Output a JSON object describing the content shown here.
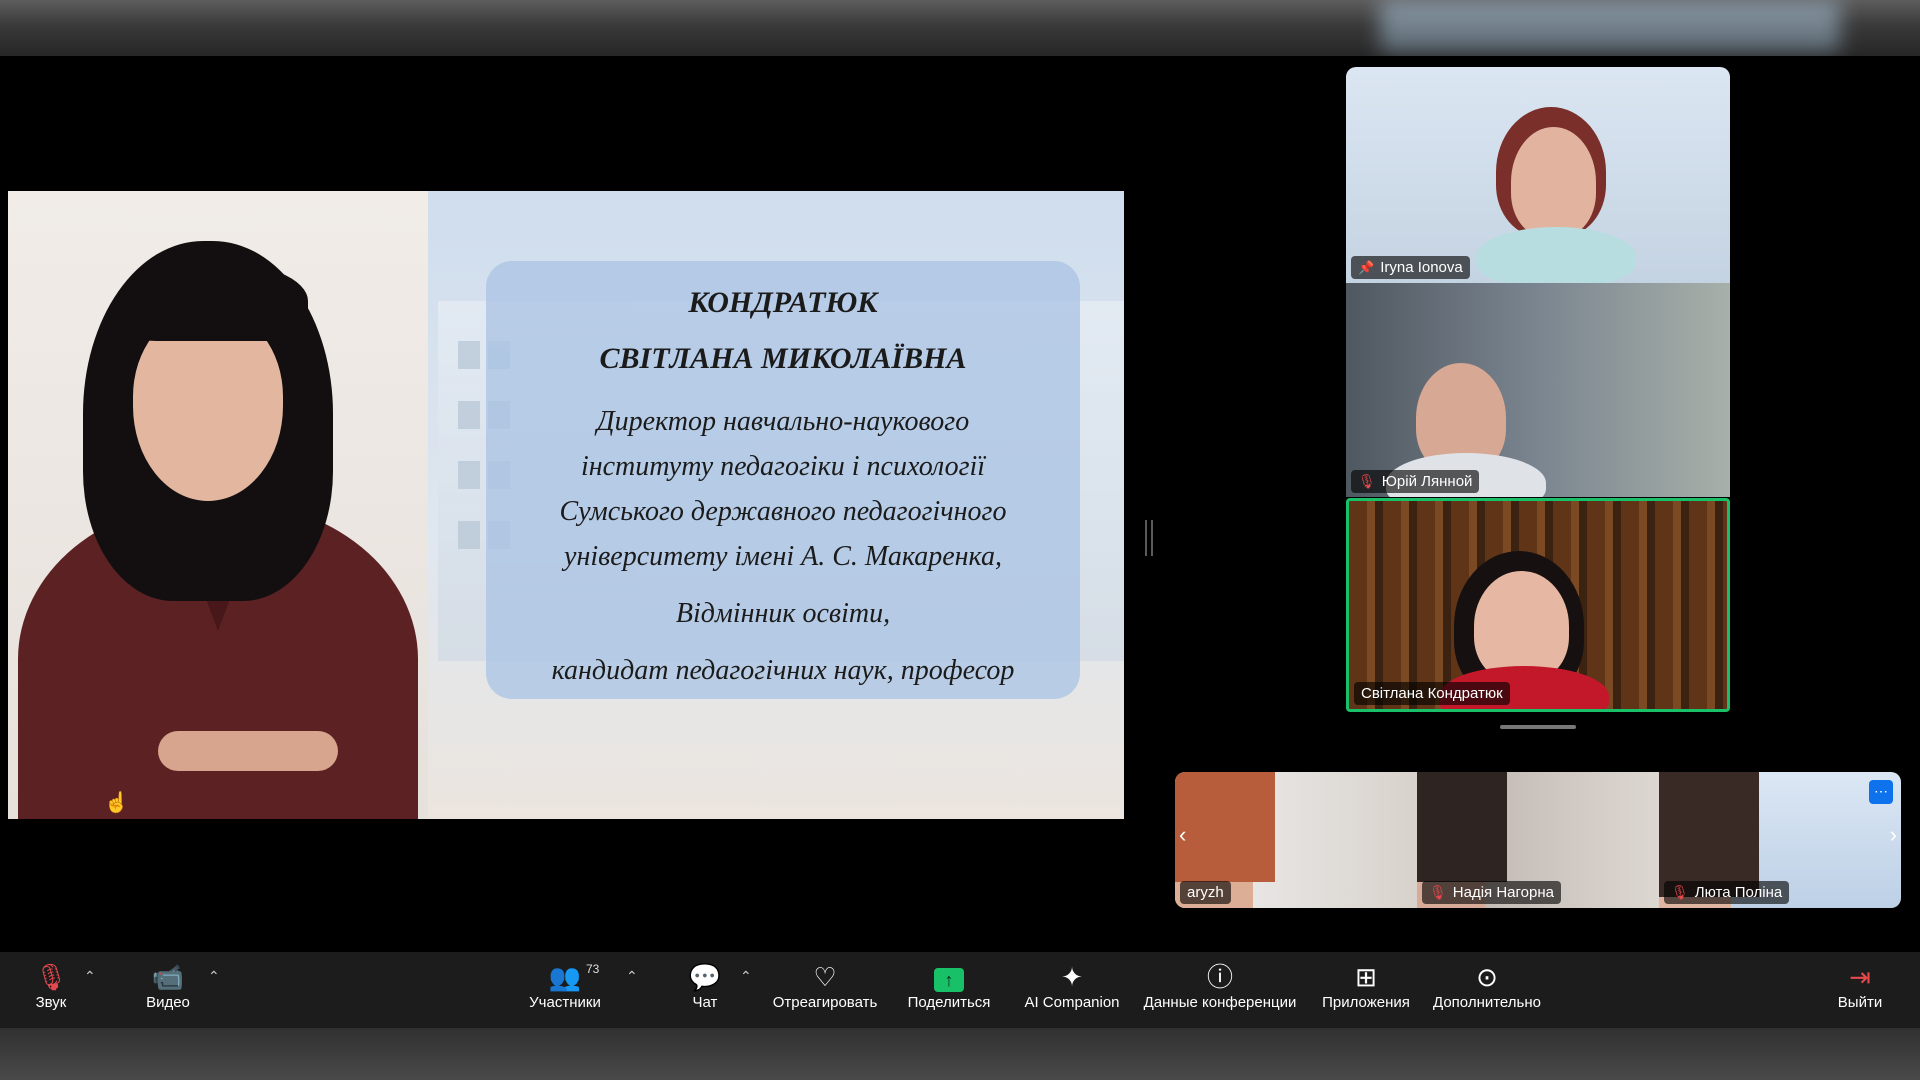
{
  "slide": {
    "surname": "КОНДРАТЮК",
    "given_names": "СВІТЛАНА МИКОЛАЇВНА",
    "line1": "Директор навчально-наукового",
    "line2": "інституту педагогіки і психології",
    "line3": "Сумського державного педагогічного",
    "line4": "університету імені А. С. Макаренка,",
    "line5": "Відмінник освіти,",
    "line6": "кандидат педагогічних наук, професор"
  },
  "participants": {
    "speaker_tiles": [
      {
        "name": "Iryna Ionova",
        "muted": false,
        "pinned": true
      },
      {
        "name": "Юрій Лянной",
        "muted": true,
        "pinned": false
      },
      {
        "name": "Світлана Кондратюк",
        "muted": false,
        "pinned": false,
        "active_speaker": true
      }
    ],
    "strip_tiles": [
      {
        "name": "aryzh",
        "muted": false
      },
      {
        "name": "Надія Нагорна",
        "muted": true
      },
      {
        "name": "Люта Поліна",
        "muted": true
      }
    ]
  },
  "toolbar": {
    "audio": "Звук",
    "video": "Видео",
    "participants": "Участники",
    "participants_count": "73",
    "chat": "Чат",
    "react": "Отреагировать",
    "share": "Поделиться",
    "ai_companion": "AI Companion",
    "meeting_info": "Данные конференции",
    "apps": "Приложения",
    "more": "Дополнительно",
    "leave": "Выйти"
  },
  "colors": {
    "active_speaker_border": "#18c167",
    "share_green": "#18c167",
    "muted_red": "#e5484d",
    "toolbar_bg": "#1c1c1c"
  },
  "icons": [
    "mic-muted-icon",
    "video-icon",
    "participants-icon",
    "chat-icon",
    "heart-icon",
    "share-screen-icon",
    "ai-sparkle-icon",
    "info-icon",
    "apps-icon",
    "more-icon",
    "leave-icon",
    "pin-icon"
  ]
}
